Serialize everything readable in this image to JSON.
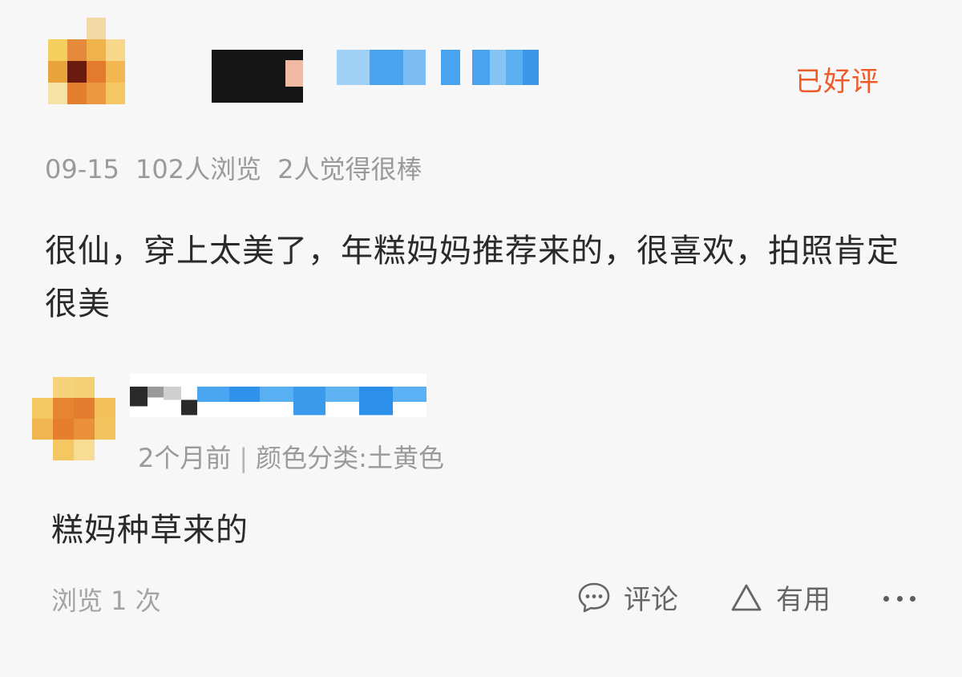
{
  "review": {
    "status_badge": "已好评",
    "meta": {
      "date": "09-15",
      "views": "102人浏览",
      "likes": "2人觉得很棒"
    },
    "content": "很仙，穿上太美了，年糕妈妈推荐来的，很喜欢，拍照肯定很美"
  },
  "reply": {
    "time": "2个月前",
    "separator": "|",
    "variant": "颜色分类:土黄色",
    "content": "糕妈种草来的"
  },
  "footer": {
    "views": "浏览 1 次",
    "comment_label": "评论",
    "useful_label": "有用",
    "icons": [
      "comment-bubble-icon",
      "triangle-up-icon",
      "more-dots-icon"
    ]
  },
  "colors": {
    "accent": "#f05a28",
    "muted_text": "#9a9a9a",
    "body_text": "#2a2a2a",
    "background": "#f7f7f7"
  }
}
